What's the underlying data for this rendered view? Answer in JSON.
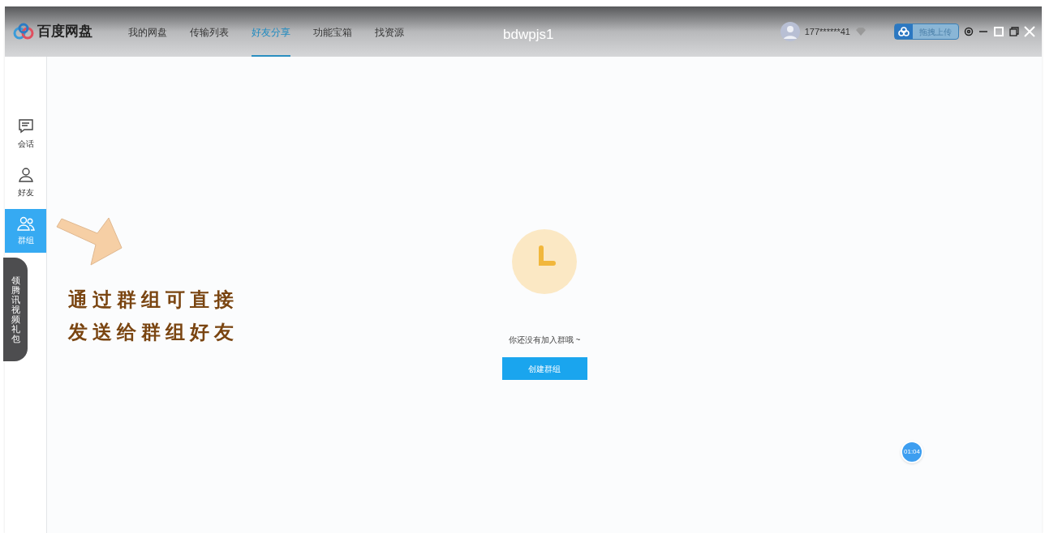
{
  "window": {
    "title": "bdwpjs1"
  },
  "app": {
    "name": "百度网盘"
  },
  "nav_tabs": [
    {
      "label": "我的网盘",
      "selected": false
    },
    {
      "label": "传输列表",
      "selected": false
    },
    {
      "label": "好友分享",
      "selected": true
    },
    {
      "label": "功能宝箱",
      "selected": false
    },
    {
      "label": "找资源",
      "selected": false
    }
  ],
  "user": {
    "account": "177******41"
  },
  "upload_widget": {
    "label": "拖拽上传"
  },
  "sidebar": {
    "items": [
      {
        "label": "会话",
        "selected": false
      },
      {
        "label": "好友",
        "selected": false
      },
      {
        "label": "群组",
        "selected": true
      }
    ]
  },
  "promo": {
    "text": "领腾讯视频礼包"
  },
  "annotation": {
    "lines": [
      "通过群组可直接",
      "发送给群组好友"
    ]
  },
  "empty_state": {
    "message": "你还没有加入群哦 ~",
    "button": "创建群组"
  },
  "timer": "01:04"
}
